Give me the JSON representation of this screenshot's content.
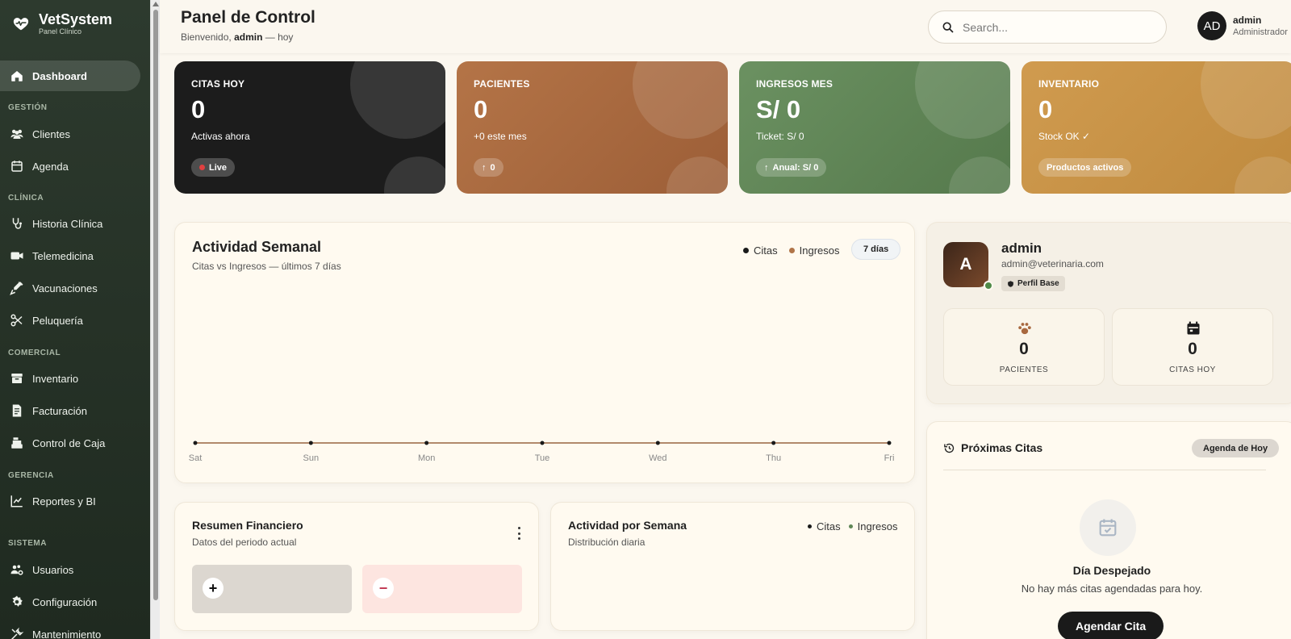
{
  "brand": {
    "name": "VetSystem",
    "subtitle": "Panel Clínico"
  },
  "sidebar": {
    "items": [
      {
        "label": "Dashboard",
        "icon": "home-icon",
        "active": true
      },
      {
        "section": "GESTIÓN"
      },
      {
        "label": "Clientes",
        "icon": "users-icon"
      },
      {
        "label": "Agenda",
        "icon": "calendar-icon"
      },
      {
        "section": "CLÍNICA"
      },
      {
        "label": "Historia Clínica",
        "icon": "stethoscope-icon"
      },
      {
        "label": "Telemedicina",
        "icon": "video-icon"
      },
      {
        "label": "Vacunaciones",
        "icon": "syringe-icon"
      },
      {
        "label": "Peluquería",
        "icon": "scissors-icon"
      },
      {
        "section": "COMERCIAL"
      },
      {
        "label": "Inventario",
        "icon": "box-icon"
      },
      {
        "label": "Facturación",
        "icon": "invoice-icon"
      },
      {
        "label": "Control de Caja",
        "icon": "cash-register-icon"
      },
      {
        "section": "GERENCIA"
      },
      {
        "label": "Reportes y BI",
        "icon": "chart-line-icon"
      },
      {
        "section": "SISTEMA"
      },
      {
        "label": "Usuarios",
        "icon": "users-cog-icon"
      },
      {
        "label": "Configuración",
        "icon": "gear-icon"
      },
      {
        "label": "Mantenimiento",
        "icon": "tools-icon"
      }
    ]
  },
  "header": {
    "title": "Panel de Control",
    "welcome_prefix": "Bienvenido,",
    "welcome_user": "admin",
    "welcome_suffix": "— hoy",
    "search_placeholder": "Search...",
    "user": {
      "initials": "AD",
      "name": "admin",
      "role": "Administrador"
    }
  },
  "stats": [
    {
      "label": "CITAS HOY",
      "value": "0",
      "sub": "Activas ahora",
      "badge": "Live",
      "color": "#1c1c1c"
    },
    {
      "label": "PACIENTES",
      "value": "0",
      "sub": "+0 este mes",
      "badge": "0",
      "color": "#a8683f"
    },
    {
      "label": "INGRESOS MES",
      "value": "S/ 0",
      "sub": "Ticket: S/ 0",
      "badge": "Anual: S/ 0",
      "color": "#5f8656"
    },
    {
      "label": "INVENTARIO",
      "value": "0",
      "sub": "Stock OK ✓",
      "badge": "Productos activos",
      "color": "#c99447"
    }
  ],
  "weekly": {
    "title": "Actividad Semanal",
    "subtitle": "Citas vs Ingresos — últimos 7 días",
    "legend": [
      "Citas",
      "Ingresos"
    ],
    "range_button": "7 días"
  },
  "chart_data": {
    "type": "line",
    "categories": [
      "Sat",
      "Sun",
      "Mon",
      "Tue",
      "Wed",
      "Thu",
      "Fri"
    ],
    "series": [
      {
        "name": "Citas",
        "values": [
          0,
          0,
          0,
          0,
          0,
          0,
          0
        ]
      },
      {
        "name": "Ingresos",
        "values": [
          0,
          0,
          0,
          0,
          0,
          0,
          0
        ]
      }
    ],
    "title": "Actividad Semanal",
    "grid": false,
    "legend": "top-right"
  },
  "financial": {
    "title": "Resumen Financiero",
    "subtitle": "Datos del periodo actual",
    "plus": "+",
    "minus": "−"
  },
  "weekly_activity": {
    "title": "Actividad por Semana",
    "subtitle": "Distribución diaria",
    "legend": [
      "Citas",
      "Ingresos"
    ]
  },
  "profile": {
    "initial": "A",
    "name": "admin",
    "email": "admin@veterinaria.com",
    "badge": "Perfil Base",
    "stats": [
      {
        "value": "0",
        "label": "PACIENTES",
        "icon": "paw-icon"
      },
      {
        "value": "0",
        "label": "CITAS HOY",
        "icon": "calendar-icon"
      }
    ]
  },
  "upcoming": {
    "title": "Próximas Citas",
    "button": "Agenda de Hoy",
    "empty_title": "Día Despejado",
    "empty_text": "No hay más citas agendadas para hoy.",
    "cta": "Agendar Cita"
  },
  "colors": {
    "citas": "#1a1a1a",
    "ingresos": "#a8683f",
    "ingresos_green": "#5f8656",
    "sidebar": "#2d3a2e"
  }
}
